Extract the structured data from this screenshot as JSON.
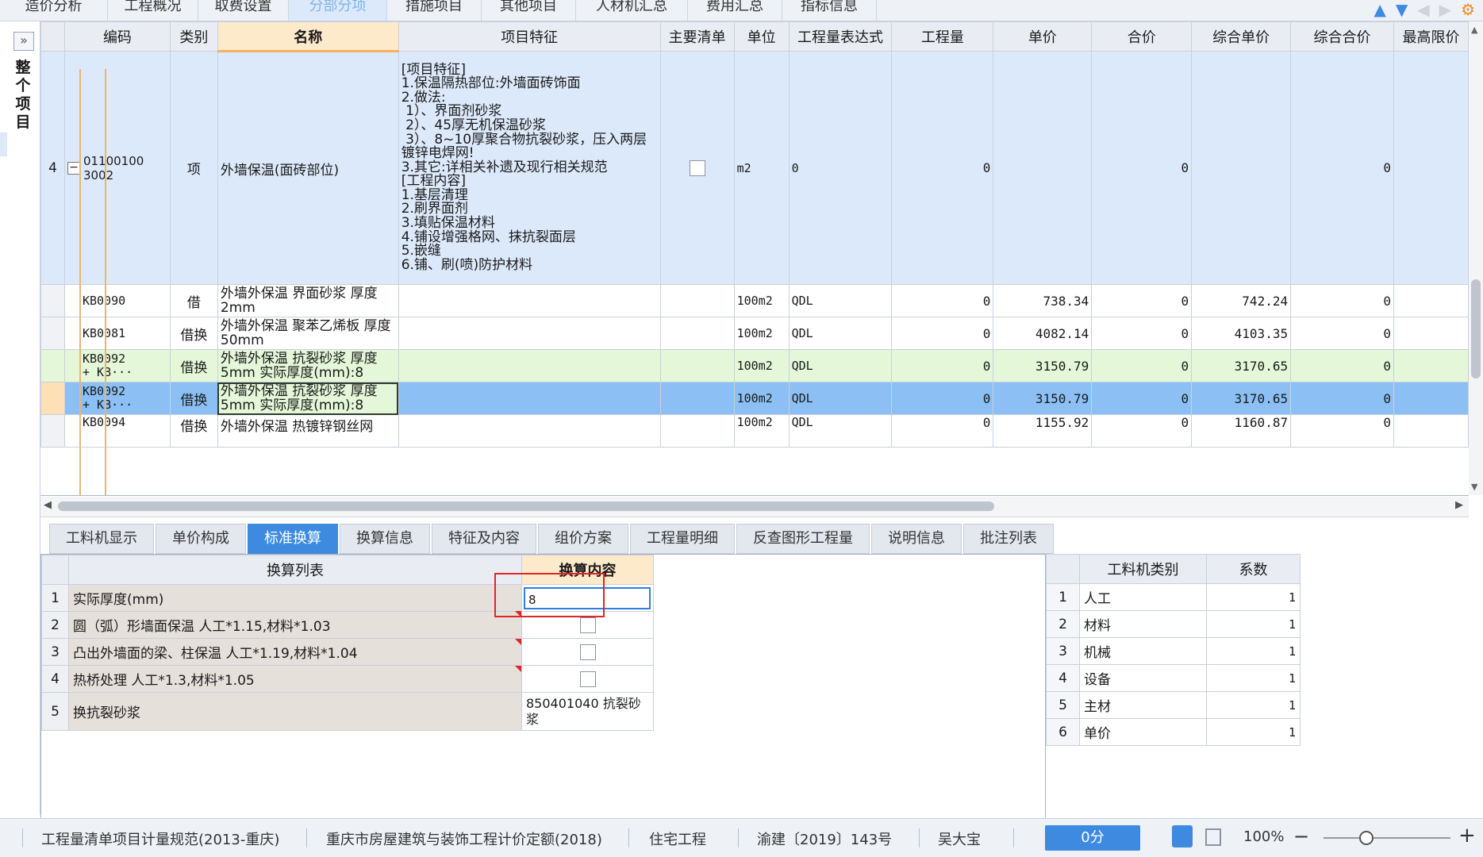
{
  "top_tabs": [
    {
      "label": "造价分析",
      "active": false
    },
    {
      "label": "工程概况",
      "active": false
    },
    {
      "label": "取费设置",
      "active": false
    },
    {
      "label": "分部分项",
      "active": true
    },
    {
      "label": "措施项目",
      "active": false
    },
    {
      "label": "其他项目",
      "active": false
    },
    {
      "label": "人材机汇总",
      "active": false
    },
    {
      "label": "费用汇总",
      "active": false
    },
    {
      "label": "指标信息",
      "active": false
    }
  ],
  "left_panel": {
    "expand_glyph": "»",
    "label": "整个项目"
  },
  "grid": {
    "headers": [
      "编码",
      "类别",
      "名称",
      "项目特征",
      "主要清单",
      "单位",
      "工程量表达式",
      "工程量",
      "单价",
      "合价",
      "综合单价",
      "综合合价",
      "最高限价"
    ],
    "main_row": {
      "num": "4",
      "code": "01100100\n3002",
      "type": "项",
      "name": "外墙保温(面砖部位)",
      "feature": "[项目特征]\n1.保温隔热部位:外墙面砖饰面\n2.做法:\n 1）、界面剂砂浆\n 2）、45厚无机保温砂浆\n 3）、8~10厚聚合物抗裂砂浆，压入两层\n镀锌电焊网!\n3.其它:详相关补遗及现行相关规范\n[工程内容]\n1.基层清理\n2.刷界面剂\n3.填贴保温材料\n4.铺设增强格网、抹抗裂面层\n5.嵌缝\n6.铺、刷(喷)防护材料",
      "unit": "m2",
      "expr": "0",
      "qty": "0",
      "unit_price": "",
      "total": "0",
      "comp_unit_price": "",
      "comp_total": "0"
    },
    "sub_rows": [
      {
        "code": "KB0090",
        "type": "借",
        "name": "外墙外保温 界面砂浆 厚度2mm",
        "unit": "100m2",
        "expr": "QDL",
        "qty": "0",
        "unit_price": "738.34",
        "total": "0",
        "comp_unit_price": "742.24",
        "comp_total": "0",
        "style": "normal"
      },
      {
        "code": "KB0081",
        "type": "借换",
        "name": "外墙外保温 聚苯乙烯板 厚度50mm",
        "unit": "100m2",
        "expr": "QDL",
        "qty": "0",
        "unit_price": "4082.14",
        "total": "0",
        "comp_unit_price": "4103.35",
        "comp_total": "0",
        "style": "normal"
      },
      {
        "code": "KB0092\n+ KB···",
        "type": "借换",
        "name": "外墙外保温 抗裂砂浆 厚度5mm  实际厚度(mm):8",
        "unit": "100m2",
        "expr": "QDL",
        "qty": "0",
        "unit_price": "3150.79",
        "total": "0",
        "comp_unit_price": "3170.65",
        "comp_total": "0",
        "style": "green"
      },
      {
        "code": "KB0092\n+ KB···",
        "type": "借换",
        "name": "外墙外保温 抗裂砂浆 厚度5mm  实际厚度(mm):8",
        "unit": "100m2",
        "expr": "QDL",
        "qty": "0",
        "unit_price": "3150.79",
        "total": "0",
        "comp_unit_price": "3170.65",
        "comp_total": "0",
        "style": "selected"
      },
      {
        "code": "KB0094",
        "type": "借换",
        "name": "外墙外保温 热镀锌钢丝网",
        "unit": "100m2",
        "expr": "QDL",
        "qty": "0",
        "unit_price": "1155.92",
        "total": "0",
        "comp_unit_price": "1160.87",
        "comp_total": "0",
        "style": "partial"
      }
    ]
  },
  "bottom_tabs": [
    {
      "label": "工料机显示",
      "active": false
    },
    {
      "label": "单价构成",
      "active": false
    },
    {
      "label": "标准换算",
      "active": true
    },
    {
      "label": "换算信息",
      "active": false
    },
    {
      "label": "特征及内容",
      "active": false
    },
    {
      "label": "组价方案",
      "active": false
    },
    {
      "label": "工程量明细",
      "active": false
    },
    {
      "label": "反查图形工程量",
      "active": false
    },
    {
      "label": "说明信息",
      "active": false
    },
    {
      "label": "批注列表",
      "active": false
    }
  ],
  "conversion": {
    "headers": [
      "换算列表",
      "换算内容"
    ],
    "rows": [
      {
        "num": "1",
        "label": "实际厚度(mm)",
        "value": "8",
        "kind": "input"
      },
      {
        "num": "2",
        "label": "圆（弧）形墙面保温 人工*1.15,材料*1.03",
        "value": "",
        "kind": "checkbox"
      },
      {
        "num": "3",
        "label": "凸出外墙面的梁、柱保温 人工*1.19,材料*1.04",
        "value": "",
        "kind": "checkbox"
      },
      {
        "num": "4",
        "label": "热桥处理 人工*1.3,材料*1.05",
        "value": "",
        "kind": "checkbox"
      },
      {
        "num": "5",
        "label": "换抗裂砂浆",
        "value": "850401040  抗裂砂浆",
        "kind": "text"
      }
    ]
  },
  "coefficients": {
    "headers": [
      "工料机类别",
      "系数"
    ],
    "rows": [
      {
        "num": "1",
        "category": "人工",
        "factor": "1"
      },
      {
        "num": "2",
        "category": "材料",
        "factor": "1"
      },
      {
        "num": "3",
        "category": "机械",
        "factor": "1"
      },
      {
        "num": "4",
        "category": "设备",
        "factor": "1"
      },
      {
        "num": "5",
        "category": "主材",
        "factor": "1"
      },
      {
        "num": "6",
        "category": "单价",
        "factor": "1"
      }
    ]
  },
  "status_bar": {
    "spec": "工程量清单项目计量规范(2013-重庆)",
    "quota": "重庆市房屋建筑与装饰工程计价定额(2018)",
    "project_type": "住宅工程",
    "document": "渝建〔2019〕143号",
    "user": "吴大宝",
    "score": "0分",
    "zoom": "100%",
    "zoom_minus": "−",
    "zoom_plus": "+"
  },
  "colors": {
    "accent": "#3d8ae0",
    "selected_row": "#8cc0f5",
    "green_row": "#e4f7d8",
    "header_highlight": "#fdeacb",
    "highlight_box": "#e02525"
  }
}
